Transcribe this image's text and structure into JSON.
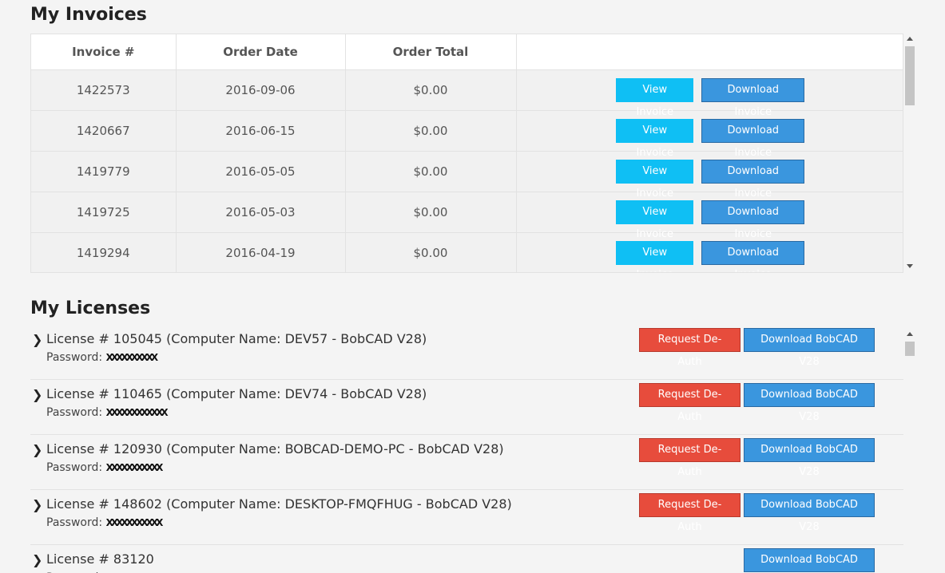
{
  "invoices": {
    "title": "My Invoices",
    "columns": [
      "Invoice #",
      "Order Date",
      "Order Total",
      ""
    ],
    "view_label": "View Invoice",
    "download_label": "Download Invoice",
    "rows": [
      {
        "number": "1422573",
        "date": "2016-09-06",
        "total": "$0.00"
      },
      {
        "number": "1420667",
        "date": "2016-06-15",
        "total": "$0.00"
      },
      {
        "number": "1419779",
        "date": "2016-05-05",
        "total": "$0.00"
      },
      {
        "number": "1419725",
        "date": "2016-05-03",
        "total": "$0.00"
      },
      {
        "number": "1419294",
        "date": "2016-04-19",
        "total": "$0.00"
      }
    ]
  },
  "licenses": {
    "title": "My Licenses",
    "password_label": "Password:",
    "deauth_label": "Request De-Auth",
    "download_label": "Download BobCAD V28",
    "items": [
      {
        "title": "License # 105045 (Computer Name: DEV57 - BobCAD V28)",
        "password_mask": "XXXXXXXXXX",
        "can_deauth": true
      },
      {
        "title": "License # 110465 (Computer Name: DEV74 - BobCAD V28)",
        "password_mask": "XXXXXXXXXXXX",
        "can_deauth": true
      },
      {
        "title": "License # 120930 (Computer Name: BOBCAD-DEMO-PC - BobCAD V28)",
        "password_mask": "XXXXXXXXXXX",
        "can_deauth": true
      },
      {
        "title": "License # 148602 (Computer Name: DESKTOP-FMQFHUG - BobCAD V28)",
        "password_mask": "XXXXXXXXXXX",
        "can_deauth": true
      },
      {
        "title": "License # 83120",
        "password_mask": "XXXXXXXXXX",
        "can_deauth": false
      }
    ]
  },
  "icons": {
    "chevron": "chevron-right-icon"
  }
}
